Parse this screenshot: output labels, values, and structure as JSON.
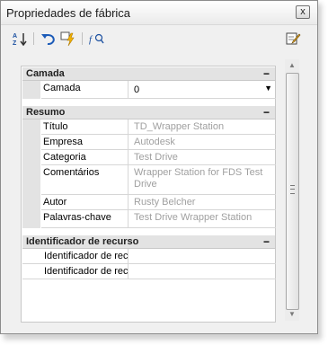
{
  "window": {
    "title": "Propriedades de fábrica"
  },
  "titlebar": {
    "close_label": "x"
  },
  "toolbar": {
    "sort_icon_text": "A Z"
  },
  "sections": {
    "camada": {
      "label": "Camada",
      "collapse": "−",
      "rows": [
        {
          "key": "Camada",
          "value": "0"
        }
      ]
    },
    "resumo": {
      "label": "Resumo",
      "collapse": "−",
      "rows": [
        {
          "key": "Título",
          "value": "TD_Wrapper Station"
        },
        {
          "key": "Empresa",
          "value": "Autodesk"
        },
        {
          "key": "Categoria",
          "value": "Test Drive"
        },
        {
          "key": "Comentários",
          "value": "Wrapper Station for FDS Test Drive"
        },
        {
          "key": "Autor",
          "value": "Rusty Belcher"
        },
        {
          "key": "Palavras-chave",
          "value": "Test Drive Wrapper Station"
        }
      ]
    },
    "recurso": {
      "label": "Identificador de recurso",
      "collapse": "−",
      "rows": [
        {
          "key": "Identificador de recurso",
          "value": ""
        },
        {
          "key": "Identificador de recurso",
          "value": ""
        }
      ]
    }
  }
}
